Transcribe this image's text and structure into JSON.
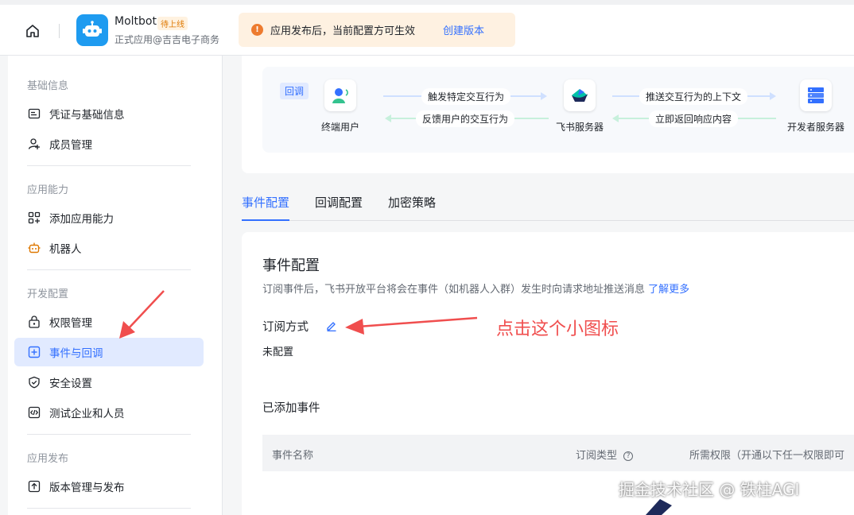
{
  "header": {
    "app_name": "Moltbot",
    "app_badge": "待上线",
    "app_subtitle": "正式应用@吉吉电子商务",
    "notice_text": "应用发布后，当前配置方可生效",
    "notice_link": "创建版本",
    "warn_glyph": "!"
  },
  "sidebar": {
    "sections": [
      {
        "title": "基础信息",
        "items": [
          {
            "label": "凭证与基础信息",
            "icon": "id-card-icon"
          },
          {
            "label": "成员管理",
            "icon": "user-plus-icon"
          }
        ]
      },
      {
        "title": "应用能力",
        "items": [
          {
            "label": "添加应用能力",
            "icon": "grid-plus-icon"
          },
          {
            "label": "机器人",
            "icon": "robot-icon"
          }
        ]
      },
      {
        "title": "开发配置",
        "items": [
          {
            "label": "权限管理",
            "icon": "lock-icon"
          },
          {
            "label": "事件与回调",
            "icon": "event-icon",
            "active": true
          },
          {
            "label": "安全设置",
            "icon": "shield-icon"
          },
          {
            "label": "测试企业和人员",
            "icon": "code-icon"
          }
        ]
      },
      {
        "title": "应用发布",
        "items": [
          {
            "label": "版本管理与发布",
            "icon": "upload-icon"
          }
        ]
      }
    ]
  },
  "flow": {
    "tag": "回调",
    "nodes": [
      "终端用户",
      "飞书服务器",
      "开发者服务器"
    ],
    "arrows": [
      "触发特定交互行为",
      "反馈用户的交互行为",
      "推送交互行为的上下文",
      "立即返回响应内容"
    ]
  },
  "tabs": [
    "事件配置",
    "回调配置",
    "加密策略"
  ],
  "event_config": {
    "title": "事件配置",
    "desc": "订阅事件后，飞书开放平台将会在事件（如机器人入群）发生时向请求地址推送消息",
    "learn_more": "了解更多",
    "subscription_label": "订阅方式",
    "subscription_value": "未配置",
    "added_title": "已添加事件",
    "table_headers": [
      "事件名称",
      "订阅类型",
      "所需权限（开通以下任一权限即可"
    ],
    "help_glyph": "?"
  },
  "annotation": "点击这个小图标",
  "watermark": "掘金技术社区 @ 铁柱AGI",
  "colors": {
    "accent": "#3370ff",
    "active_bg": "#e1eaff",
    "annotation": "#f04e4e",
    "notice_bg": "#fef1e1"
  }
}
